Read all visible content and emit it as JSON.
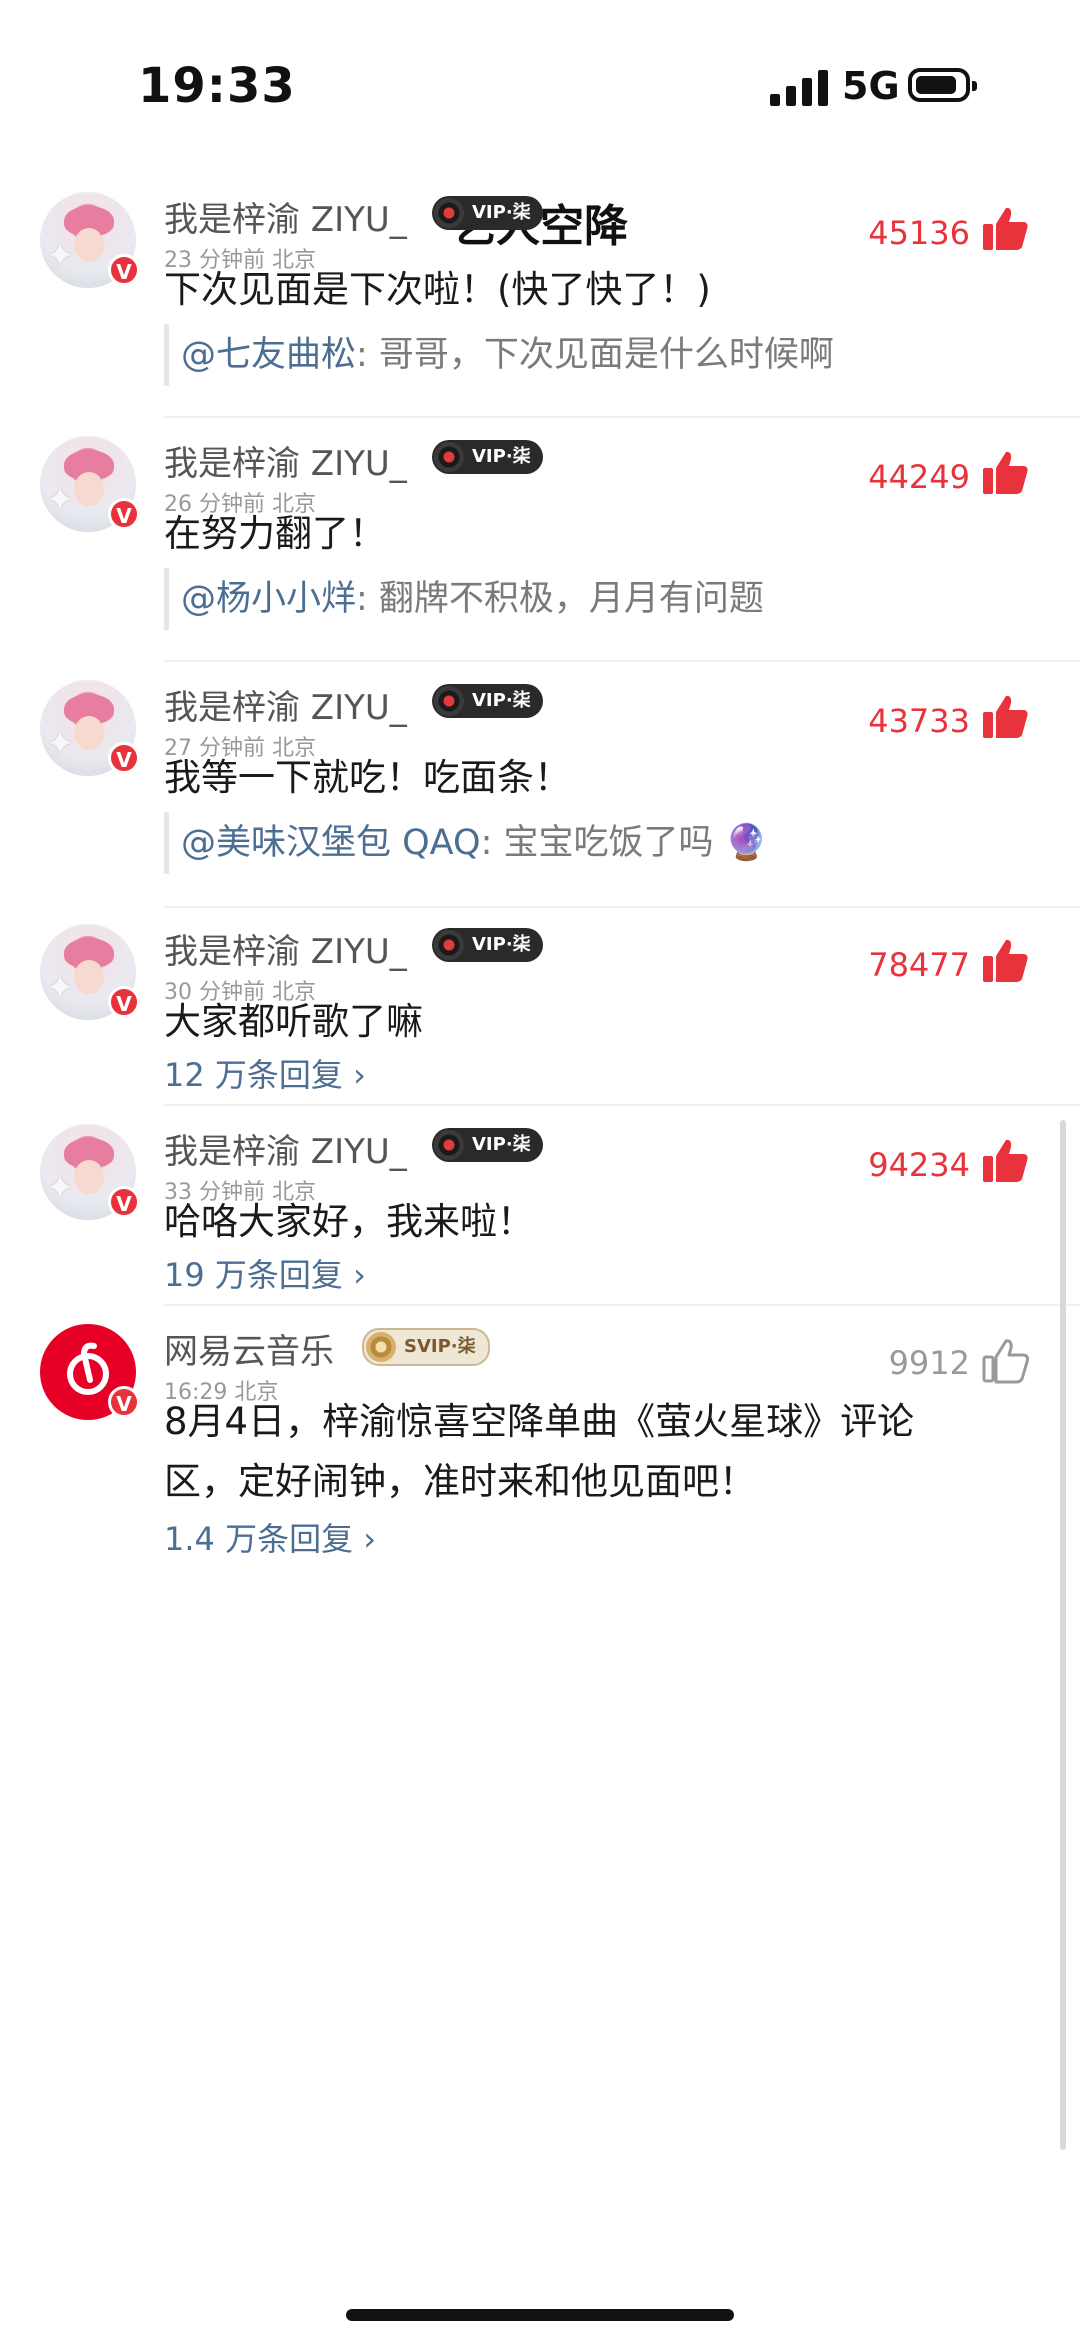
{
  "status_bar": {
    "time": "19:33",
    "network": "5G"
  },
  "nav": {
    "title": "艺人空降"
  },
  "comments": [
    {
      "user": "我是梓渝 ZIYU_",
      "vip": "VIP·柒",
      "time": "23 分钟前",
      "location": "北京",
      "likes": "45136",
      "text": "下次见面是下次啦！(快了快了！)",
      "quote_user": "@七友曲松",
      "quote_text": ": 哥哥，下次见面是什么时候啊"
    },
    {
      "user": "我是梓渝 ZIYU_",
      "vip": "VIP·柒",
      "time": "26 分钟前",
      "location": "北京",
      "likes": "44249",
      "text": "在努力翻了！",
      "quote_user": "@杨小小烊",
      "quote_text": ": 翻牌不积极，月月有问题"
    },
    {
      "user": "我是梓渝 ZIYU_",
      "vip": "VIP·柒",
      "time": "27 分钟前",
      "location": "北京",
      "likes": "43733",
      "text": "我等一下就吃！吃面条！",
      "quote_user": "@美味汉堡包 QAQ",
      "quote_text": ": 宝宝吃饭了吗 🔮"
    },
    {
      "user": "我是梓渝 ZIYU_",
      "vip": "VIP·柒",
      "time": "30 分钟前",
      "location": "北京",
      "likes": "78477",
      "text": "大家都听歌了嘛",
      "replies": "12 万条回复 ›"
    },
    {
      "user": "我是梓渝 ZIYU_",
      "vip": "VIP·柒",
      "time": "33 分钟前",
      "location": "北京",
      "likes": "94234",
      "text": "哈咯大家好，我来啦！",
      "replies": "19 万条回复 ›"
    },
    {
      "user": "网易云音乐",
      "vip": "SVIP·柒",
      "time": "16:29",
      "location": "北京",
      "likes": "9912",
      "text_line1": "8月4日，梓渝惊喜空降单曲《萤火星球》评论",
      "text_line2": "区，定好闹钟，准时来和他见面吧！",
      "replies": "1.4 万条回复 ›"
    }
  ],
  "colors": {
    "accent_red": "#e8323c",
    "link_blue": "#4d6e93",
    "netease_red": "#e60026"
  },
  "icons": {
    "back": "chevron-left-icon",
    "like": "thumbs-up-icon",
    "vip_disc": "vinyl-disc-icon"
  }
}
